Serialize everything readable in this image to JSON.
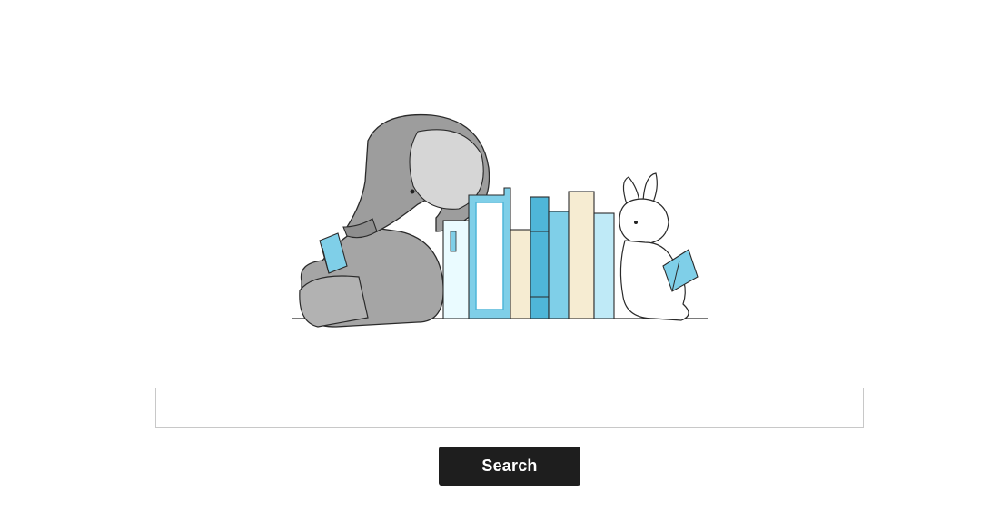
{
  "hero": {
    "icon": "elephant-books-bunny-illustration",
    "colors": {
      "elephant": "#9d9d9d",
      "elephant_light": "#c7c7c7",
      "book_blue": "#7fcfe8",
      "book_blue_dark": "#4fb6d8",
      "book_cream": "#f6ecd2",
      "outline": "#2a2a2a"
    }
  },
  "search": {
    "placeholder": "",
    "value": "",
    "button_label": "Search",
    "button_color": "#1e1e1e"
  }
}
